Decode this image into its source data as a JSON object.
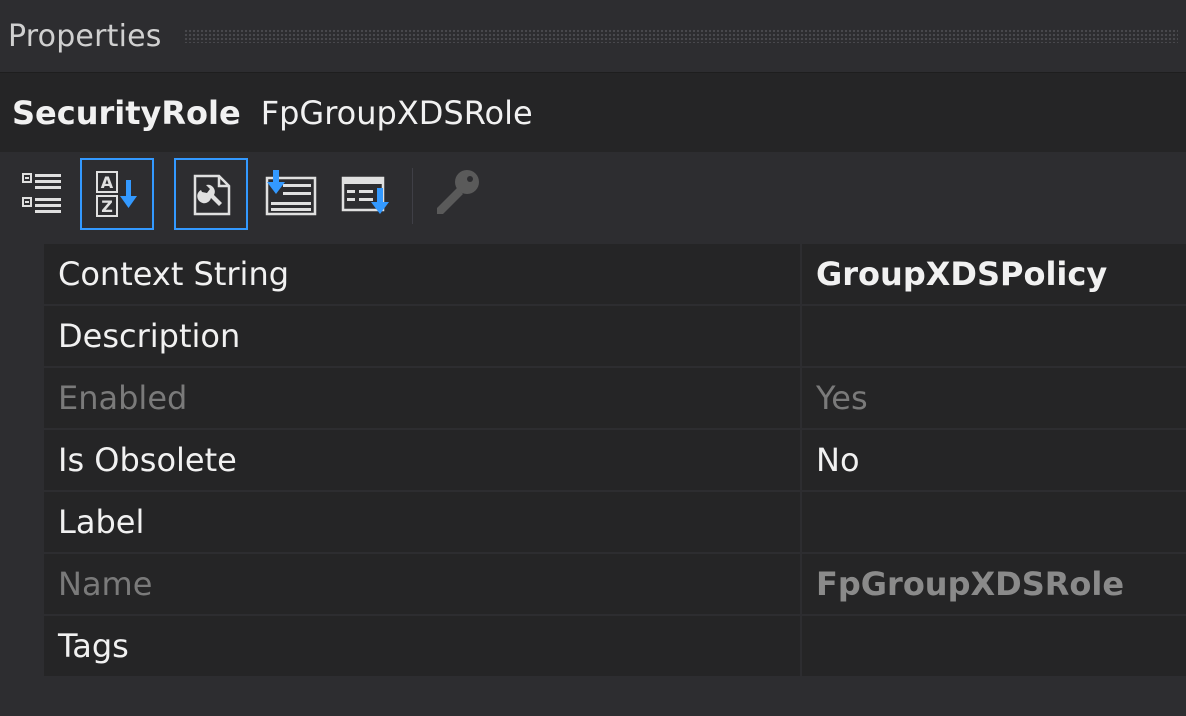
{
  "panel": {
    "title": "Properties"
  },
  "object": {
    "type": "SecurityRole",
    "name": "FpGroupXDSRole"
  },
  "toolbar": {
    "buttons": [
      {
        "icon": "categorized-icon",
        "active": false
      },
      {
        "icon": "alphabetical-icon",
        "active": true
      },
      {
        "icon": "properties-icon",
        "active": true
      },
      {
        "icon": "events-icon",
        "active": false
      },
      {
        "icon": "property-pages-icon",
        "active": false
      },
      {
        "icon": "key-icon",
        "active": false
      }
    ]
  },
  "properties": [
    {
      "name": "Context String",
      "value": "GroupXDSPolicy",
      "bold": true,
      "disabled": false
    },
    {
      "name": "Description",
      "value": "",
      "bold": false,
      "disabled": false
    },
    {
      "name": "Enabled",
      "value": "Yes",
      "bold": false,
      "disabled": true
    },
    {
      "name": "Is Obsolete",
      "value": "No",
      "bold": false,
      "disabled": false
    },
    {
      "name": "Label",
      "value": "",
      "bold": false,
      "disabled": false
    },
    {
      "name": "Name",
      "value": "FpGroupXDSRole",
      "bold": true,
      "disabled": true
    },
    {
      "name": "Tags",
      "value": "",
      "bold": false,
      "disabled": false
    }
  ],
  "colors": {
    "background": "#2d2d30",
    "grid_row": "#252526",
    "accent": "#3399ff",
    "disabled_text": "#7a7a7a"
  }
}
